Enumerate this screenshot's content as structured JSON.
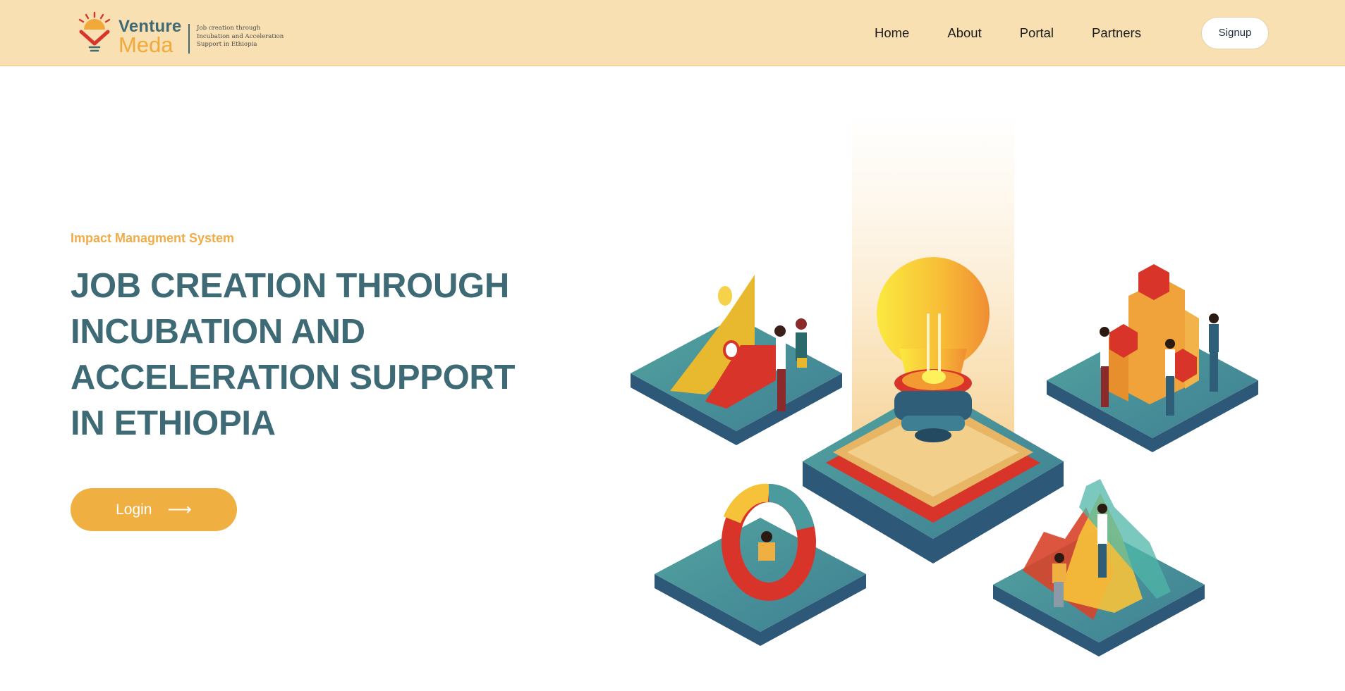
{
  "brand": {
    "name_line1": "Venture",
    "name_line2": "Meda",
    "tagline": "Job creation through Incubation and Acceleration Support in Ethiopia"
  },
  "nav": {
    "items": [
      {
        "label": "Home"
      },
      {
        "label": "About"
      },
      {
        "label": "Portal"
      },
      {
        "label": "Partners"
      }
    ],
    "signup_label": "Signup"
  },
  "hero": {
    "eyebrow": "Impact Managment System",
    "title": "JOB CREATION THROUGH INCUBATION AND ACCELERATION SUPPORT IN ETHIOPIA",
    "login_label": "Login",
    "login_icon": "arrow-right-icon"
  },
  "illustration": {
    "subject": "isometric-platforms-lightbulb-icon",
    "colors": {
      "teal": "#4a9a9e",
      "teal_dark": "#2f5f78",
      "yellow": "#f6c23a",
      "orange": "#ef8f2c",
      "red": "#d8342a"
    }
  },
  "colors": {
    "header_bg": "#f8e0b3",
    "accent": "#f0b041",
    "title": "#3e6a76"
  }
}
